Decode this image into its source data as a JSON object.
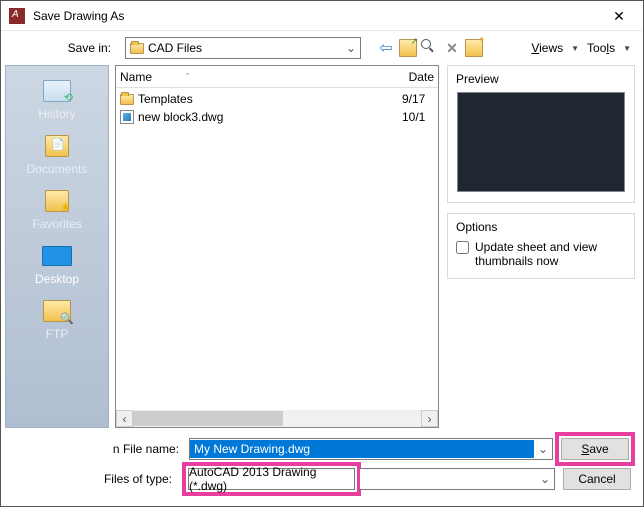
{
  "window": {
    "title": "Save Drawing As"
  },
  "toolbar": {
    "save_in_label": "Save in:",
    "save_in_value": "CAD Files",
    "views_label": "Views",
    "tools_label": "Tools"
  },
  "sidebar": {
    "items": [
      {
        "label": "History"
      },
      {
        "label": "Documents"
      },
      {
        "label": "Favorites"
      },
      {
        "label": "Desktop"
      },
      {
        "label": "FTP"
      }
    ]
  },
  "list": {
    "columns": {
      "name": "Name",
      "date": "Date"
    },
    "rows": [
      {
        "name": "Templates",
        "date": "9/17",
        "type": "folder"
      },
      {
        "name": "new block3.dwg",
        "date": "10/1",
        "type": "dwg"
      }
    ]
  },
  "right": {
    "preview_label": "Preview",
    "options_label": "Options",
    "update_thumb_label": "Update sheet and view thumbnails now",
    "update_thumb_checked": false
  },
  "footer": {
    "filename_label": "File name:",
    "filename_value": "My New Drawing.dwg",
    "filetype_label": "Files of type:",
    "filetype_value": "AutoCAD 2013 Drawing (*.dwg)",
    "save_label": "Save",
    "cancel_label": "Cancel"
  }
}
